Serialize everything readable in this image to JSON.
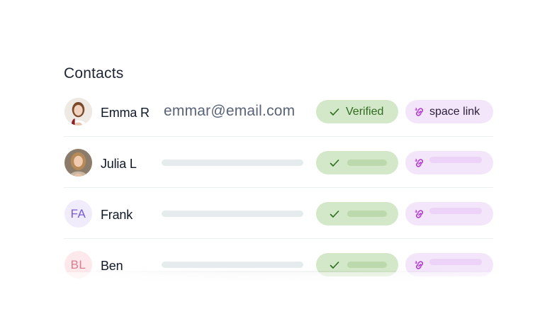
{
  "title": "Contacts",
  "contacts": [
    {
      "name": "Emma R",
      "email": "emmar@email.com",
      "avatar": "photo",
      "status_label": "Verified",
      "link_label": "space link"
    },
    {
      "name": "Julia L",
      "avatar": "photo"
    },
    {
      "name": "Frank",
      "avatar_initials": "FA",
      "avatar_bg": "#f1ecfb",
      "avatar_color": "#7b5ad6"
    },
    {
      "name": "Ben",
      "avatar_initials": "BL",
      "avatar_bg": "#fde9ec",
      "avatar_color": "#e07a8e"
    }
  ],
  "colors": {
    "verified_bg": "#d3e8c8",
    "verified_text": "#2f6b21",
    "link_bg": "#f3e6fb",
    "link_icon": "#b23bd1"
  },
  "icons": {
    "status": "check-icon",
    "link": "link-chain-icon"
  }
}
